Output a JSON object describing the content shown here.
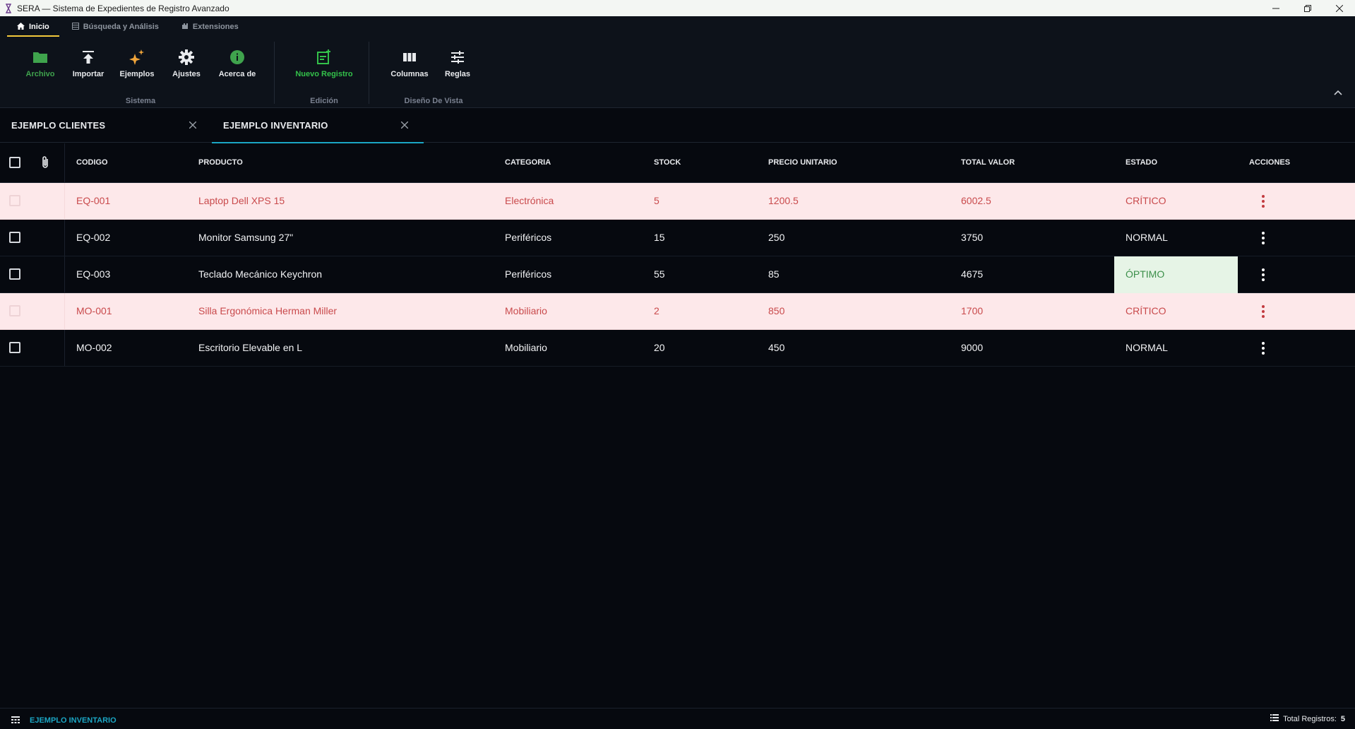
{
  "window": {
    "title": "SERA — Sistema de Expedientes de Registro Avanzado",
    "controls": [
      "minimize",
      "restore",
      "close"
    ]
  },
  "ribbon_tabs": [
    {
      "label": "Inicio",
      "icon": "home-icon",
      "active": true
    },
    {
      "label": "Búsqueda y Análisis",
      "icon": "table-icon",
      "active": false
    },
    {
      "label": "Extensiones",
      "icon": "puzzle-icon",
      "active": false
    }
  ],
  "ribbon": {
    "groups": [
      {
        "label": "Sistema",
        "buttons": [
          {
            "label": "Archivo",
            "icon": "folder-icon",
            "color": "#3fa34d"
          },
          {
            "label": "Importar",
            "icon": "upload-icon",
            "color": "#e8eaed"
          },
          {
            "label": "Ejemplos",
            "icon": "sparkle-icon",
            "color": "#e8eaed"
          },
          {
            "label": "Ajustes",
            "icon": "gear-icon",
            "color": "#e8eaed"
          },
          {
            "label": "Acerca de",
            "icon": "info-icon",
            "color": "#e8eaed"
          }
        ]
      },
      {
        "label": "Edición",
        "buttons": [
          {
            "label": "Nuevo Registro",
            "icon": "new-record-icon",
            "color": "#33c14a"
          }
        ]
      },
      {
        "label": "Diseño De Vista",
        "buttons": [
          {
            "label": "Columnas",
            "icon": "columns-icon",
            "color": "#e8eaed"
          },
          {
            "label": "Reglas",
            "icon": "sliders-icon",
            "color": "#e8eaed"
          }
        ]
      }
    ]
  },
  "doc_tabs": [
    {
      "label": "EJEMPLO CLIENTES",
      "active": false
    },
    {
      "label": "EJEMPLO INVENTARIO",
      "active": true
    }
  ],
  "table": {
    "columns": [
      "CODIGO",
      "PRODUCTO",
      "CATEGORIA",
      "STOCK",
      "PRECIO UNITARIO",
      "TOTAL VALOR",
      "ESTADO",
      "ACCIONES"
    ],
    "rows": [
      {
        "codigo": "EQ-001",
        "producto": "Laptop Dell XPS 15",
        "categoria": "Electrónica",
        "stock": "5",
        "precio": "1200.5",
        "total": "6002.5",
        "estado": "CRÍTICO",
        "style": "critical"
      },
      {
        "codigo": "EQ-002",
        "producto": "Monitor Samsung 27\"",
        "categoria": "Periféricos",
        "stock": "15",
        "precio": "250",
        "total": "3750",
        "estado": "NORMAL",
        "style": "normal"
      },
      {
        "codigo": "EQ-003",
        "producto": "Teclado Mecánico Keychron",
        "categoria": "Periféricos",
        "stock": "55",
        "precio": "85",
        "total": "4675",
        "estado": "ÓPTIMO",
        "style": "optimo"
      },
      {
        "codigo": "MO-001",
        "producto": "Silla Ergonómica Herman Miller",
        "categoria": "Mobiliario",
        "stock": "2",
        "precio": "850",
        "total": "1700",
        "estado": "CRÍTICO",
        "style": "critical"
      },
      {
        "codigo": "MO-002",
        "producto": "Escritorio Elevable en L",
        "categoria": "Mobiliario",
        "stock": "20",
        "precio": "450",
        "total": "9000",
        "estado": "NORMAL",
        "style": "normal"
      }
    ]
  },
  "statusbar": {
    "active_table": "EJEMPLO INVENTARIO",
    "total_label": "Total Registros:",
    "total_count": "5"
  },
  "colors": {
    "accent": "#1ba6c4",
    "critical_bg": "#fde8ea",
    "critical_text": "#c94a4c",
    "optimo_bg": "#e6f4e6",
    "optimo_text": "#3c8f4a",
    "tab_underline": "#f2c83b"
  }
}
